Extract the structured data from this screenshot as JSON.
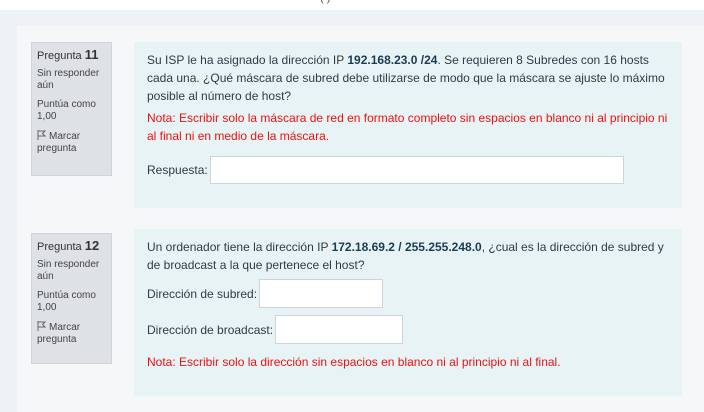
{
  "top_clip": "(          )",
  "questions": [
    {
      "number_prefix": "Pregunta",
      "number": "11",
      "state": "Sin responder aún",
      "grade": "Puntúa como 1,00",
      "flag_label": "Marcar pregunta",
      "text_a": "Su ISP le ha asignado la dirección IP ",
      "ip": "192.168.23.0 /24",
      "text_b": ". Se requieren 8 Subredes con 16 hosts cada una. ¿Qué máscara de subred debe utilizarse de modo que la máscara se ajuste lo máximo posible al número de host?",
      "note": "Nota: Escribir solo la máscara de red en formato completo sin espacios en blanco ni al principio ni al final ni en medio de la máscara.",
      "answer_label": "Respuesta:",
      "answer_value": ""
    },
    {
      "number_prefix": "Pregunta",
      "number": "12",
      "state": "Sin responder aún",
      "grade": "Puntúa como 1,00",
      "flag_label": "Marcar pregunta",
      "text_a": "Un ordenador tiene la dirección IP ",
      "ip": "172.18.69.2 / 255.255.248.0",
      "text_b": ", ¿cual es la dirección de subred y de broadcast a la que pertenece el host?",
      "subnet_label": "Dirección de subred:",
      "subnet_value": "",
      "broadcast_label": "Dirección de broadcast:",
      "broadcast_value": "",
      "note": "Nota: Escribir solo la dirección sin espacios en blanco ni al principio ni al final."
    }
  ],
  "colors": {
    "note": "#ee1111",
    "content_bg": "#e7f3f5",
    "info_bg": "#dee2e6",
    "page_bg": "#eef2f6"
  }
}
